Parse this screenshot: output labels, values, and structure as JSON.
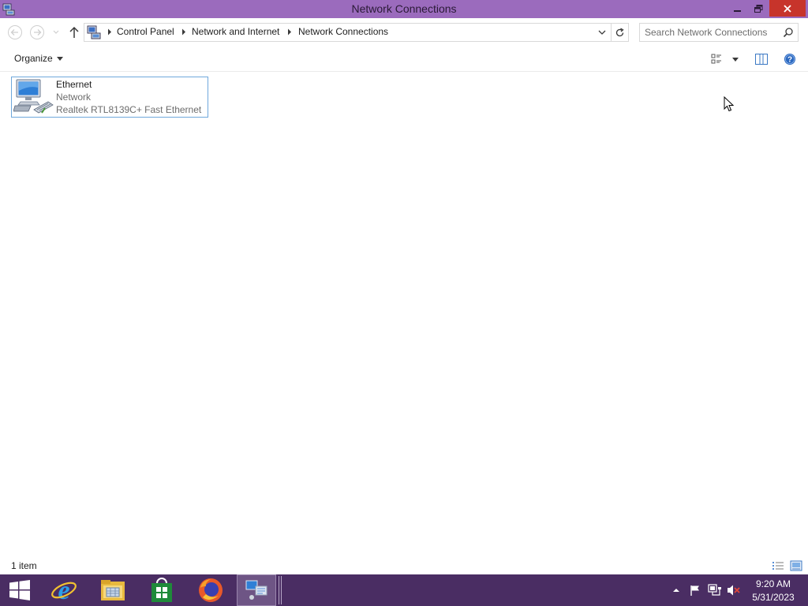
{
  "window": {
    "title": "Network Connections",
    "title_bar_color": "#9b6bbd",
    "close_button_color": "#c7342b",
    "icons": {
      "app": "network-connections-icon",
      "minimize": "minimize-icon",
      "maximize": "restore-icon",
      "close": "close-icon"
    }
  },
  "navigation": {
    "back_icon": "back-arrow-icon",
    "forward_icon": "forward-arrow-icon",
    "recent_icon": "chevron-down-icon",
    "up_icon": "up-arrow-icon",
    "breadcrumbs": [
      {
        "label": "Control Panel"
      },
      {
        "label": "Network and Internet"
      },
      {
        "label": "Network Connections"
      }
    ],
    "refresh_icon": "refresh-icon",
    "search": {
      "placeholder": "Search Network Connections",
      "value": ""
    }
  },
  "toolbar": {
    "organize_label": "Organize",
    "icons": [
      "change-view-icon",
      "preview-pane-icon",
      "help-icon"
    ]
  },
  "items": [
    {
      "name": "Ethernet",
      "status": "Network",
      "device": "Realtek RTL8139C+ Fast Ethernet ...",
      "icon": "ethernet-adapter-icon"
    }
  ],
  "status_bar": {
    "item_count": "1 item",
    "view_icons": [
      "details-view-icon",
      "large-icons-view-icon"
    ]
  },
  "taskbar": {
    "color": "#4a2d63",
    "apps": [
      {
        "name": "Start",
        "icon": "windows-logo-icon"
      },
      {
        "name": "Internet Explorer",
        "icon": "internet-explorer-icon"
      },
      {
        "name": "File Explorer",
        "icon": "file-explorer-icon"
      },
      {
        "name": "Store",
        "icon": "store-icon"
      },
      {
        "name": "Firefox",
        "icon": "firefox-icon"
      },
      {
        "name": "Network Connections",
        "icon": "network-connections-icon",
        "active": true
      }
    ],
    "tray_icons": [
      "show-hidden-icons-icon",
      "action-center-flag-icon",
      "network-icon",
      "volume-muted-icon"
    ],
    "clock": {
      "time": "9:20 AM",
      "date": "5/31/2023"
    }
  }
}
